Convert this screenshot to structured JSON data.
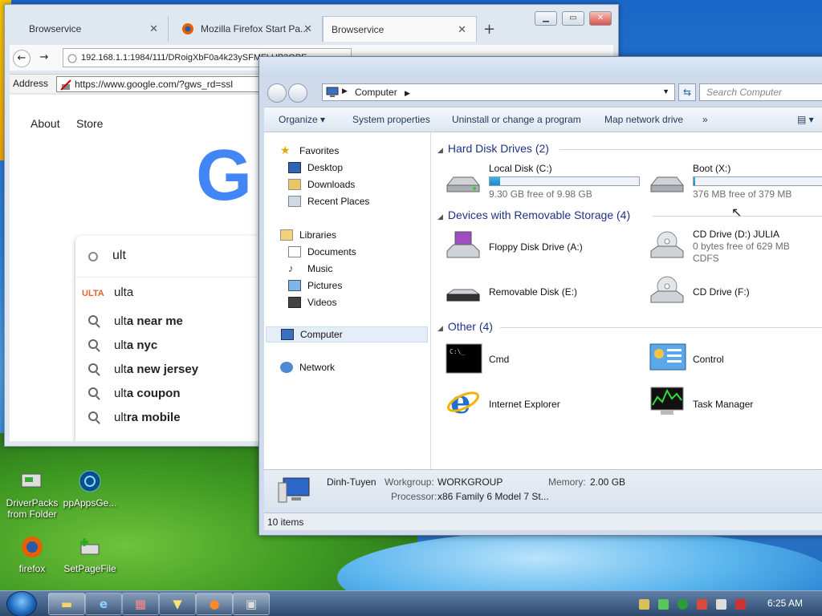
{
  "firefox": {
    "tabs": [
      {
        "label": "Browservice"
      },
      {
        "label": "Mozilla Firefox Start Pa..."
      },
      {
        "label": "Browservice"
      }
    ],
    "url": "192.168.1.1:1984/111/DRoigXbF0a4k23ySFMFLHP3QPE",
    "address_label": "Address",
    "address_value": "https://www.google.com/?gws_rd=ssl",
    "google": {
      "links": [
        "About",
        "Store"
      ],
      "logo_text": "G",
      "query": "ult",
      "suggestions": [
        {
          "typed": "ult",
          "completion": "a",
          "brand": "ULTA"
        },
        {
          "typed": "ult",
          "completion": "a near me"
        },
        {
          "typed": "ult",
          "completion": "a nyc"
        },
        {
          "typed": "ult",
          "completion": "a new jersey"
        },
        {
          "typed": "ult",
          "completion": "a coupon"
        },
        {
          "typed": "ult",
          "completion": "ra mobile"
        }
      ]
    }
  },
  "explorer": {
    "breadcrumb": "Computer",
    "search_placeholder": "Search Computer",
    "commands": [
      "Organize",
      "System properties",
      "Uninstall or change a program",
      "Map network drive",
      "»"
    ],
    "nav": {
      "favorites": "Favorites",
      "favorites_items": [
        "Desktop",
        "Downloads",
        "Recent Places"
      ],
      "libraries": "Libraries",
      "libraries_items": [
        "Documents",
        "Music",
        "Pictures",
        "Videos"
      ],
      "computer": "Computer",
      "network": "Network"
    },
    "groups": {
      "hdd": "Hard Disk Drives (2)",
      "removable": "Devices with Removable Storage (4)",
      "other": "Other (4)"
    },
    "drives": {
      "c": {
        "name": "Local Disk (C:)",
        "free": "9.30 GB free of 9.98 GB",
        "used_fraction": 0.07
      },
      "x": {
        "name": "Boot (X:)",
        "free": "376 MB free of 379 MB",
        "used_fraction": 0.01
      },
      "floppy": {
        "name": "Floppy Disk Drive (A:)"
      },
      "d": {
        "name": "CD Drive (D:) JULIA",
        "free": "0 bytes free of 629 MB",
        "fs": "CDFS"
      },
      "e": {
        "name": "Removable Disk (E:)"
      },
      "f": {
        "name": "CD Drive (F:)"
      }
    },
    "other": {
      "cmd": "Cmd",
      "control": "Control",
      "ie": "Internet Explorer",
      "taskmgr": "Task Manager"
    },
    "details": {
      "name": "Dinh-Tuyen",
      "workgroup_label": "Workgroup:",
      "workgroup": "WORKGROUP",
      "memory_label": "Memory:",
      "memory": "2.00 GB",
      "processor_label": "Processor:",
      "processor": "x86 Family 6 Model 7 St..."
    },
    "status": "10 items"
  },
  "desktop": {
    "icons": [
      "DriverPacks from Folder",
      "ppAppsGe...",
      "firefox",
      "SetPageFile"
    ]
  },
  "taskbar": {
    "clock": "6:25 AM"
  }
}
